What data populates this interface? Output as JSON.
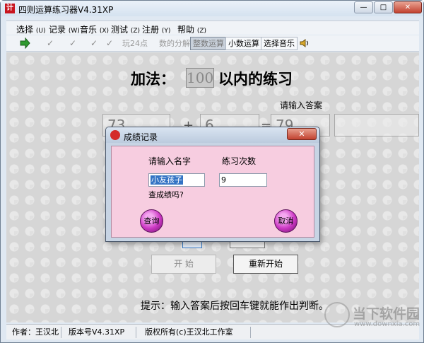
{
  "window": {
    "title": "四则运算练习器V4.31XP",
    "app_icon": "计",
    "controls": {
      "minimize": "—",
      "maximize": "□",
      "close": "✕"
    }
  },
  "menu": [
    {
      "label": "选择",
      "key": "(U)"
    },
    {
      "label": "记录",
      "key": "(W)"
    },
    {
      "label": "音乐",
      "key": "(X)"
    },
    {
      "label": "测试",
      "key": "(Z)"
    },
    {
      "label": "注册",
      "key": "(Y)"
    },
    {
      "label": "帮助",
      "key": "(Z)"
    }
  ],
  "toolbar": {
    "play_icon": "green-arrow-icon",
    "check_icons": [
      "✓",
      "✓",
      "✓",
      "✓"
    ],
    "game24": "玩24点",
    "decompose": "数的分解",
    "integer_calc": "整数运算",
    "decimal_calc": "小数运算",
    "choose_music": "选择音乐",
    "speaker_icon": "speaker-icon"
  },
  "main": {
    "op_title": "加法：",
    "range_value": "100",
    "range_suffix": "以内的练习",
    "answer_prompt": "请输入答案",
    "operand1": "73",
    "operator": "+",
    "operand2": "6",
    "equals": "=",
    "answer": "79",
    "start_label": "开 始",
    "restart_label": "重新开始",
    "tip": "提示：输入答案后按回车键就能作出判断。"
  },
  "status": {
    "author": "作者：王汉北",
    "version": "版本号V4.31XP",
    "copyright": "版权所有(c)王汉北工作室"
  },
  "watermark": {
    "name": "当下软件园",
    "url": "www.downxia.com"
  },
  "dialog": {
    "title": "成绩记录",
    "close": "✕",
    "name_label": "请输入名字",
    "count_label": "练习次数",
    "name_value": "小友孩子",
    "count_value": "9",
    "question": "查成绩吗?",
    "query_button": "查询",
    "cancel_button": "取消"
  },
  "colors": {
    "dialog_body": "#f7cde0",
    "round_button": "#cc38c4",
    "selection": "#3373c4",
    "close_red": "#c24230"
  }
}
